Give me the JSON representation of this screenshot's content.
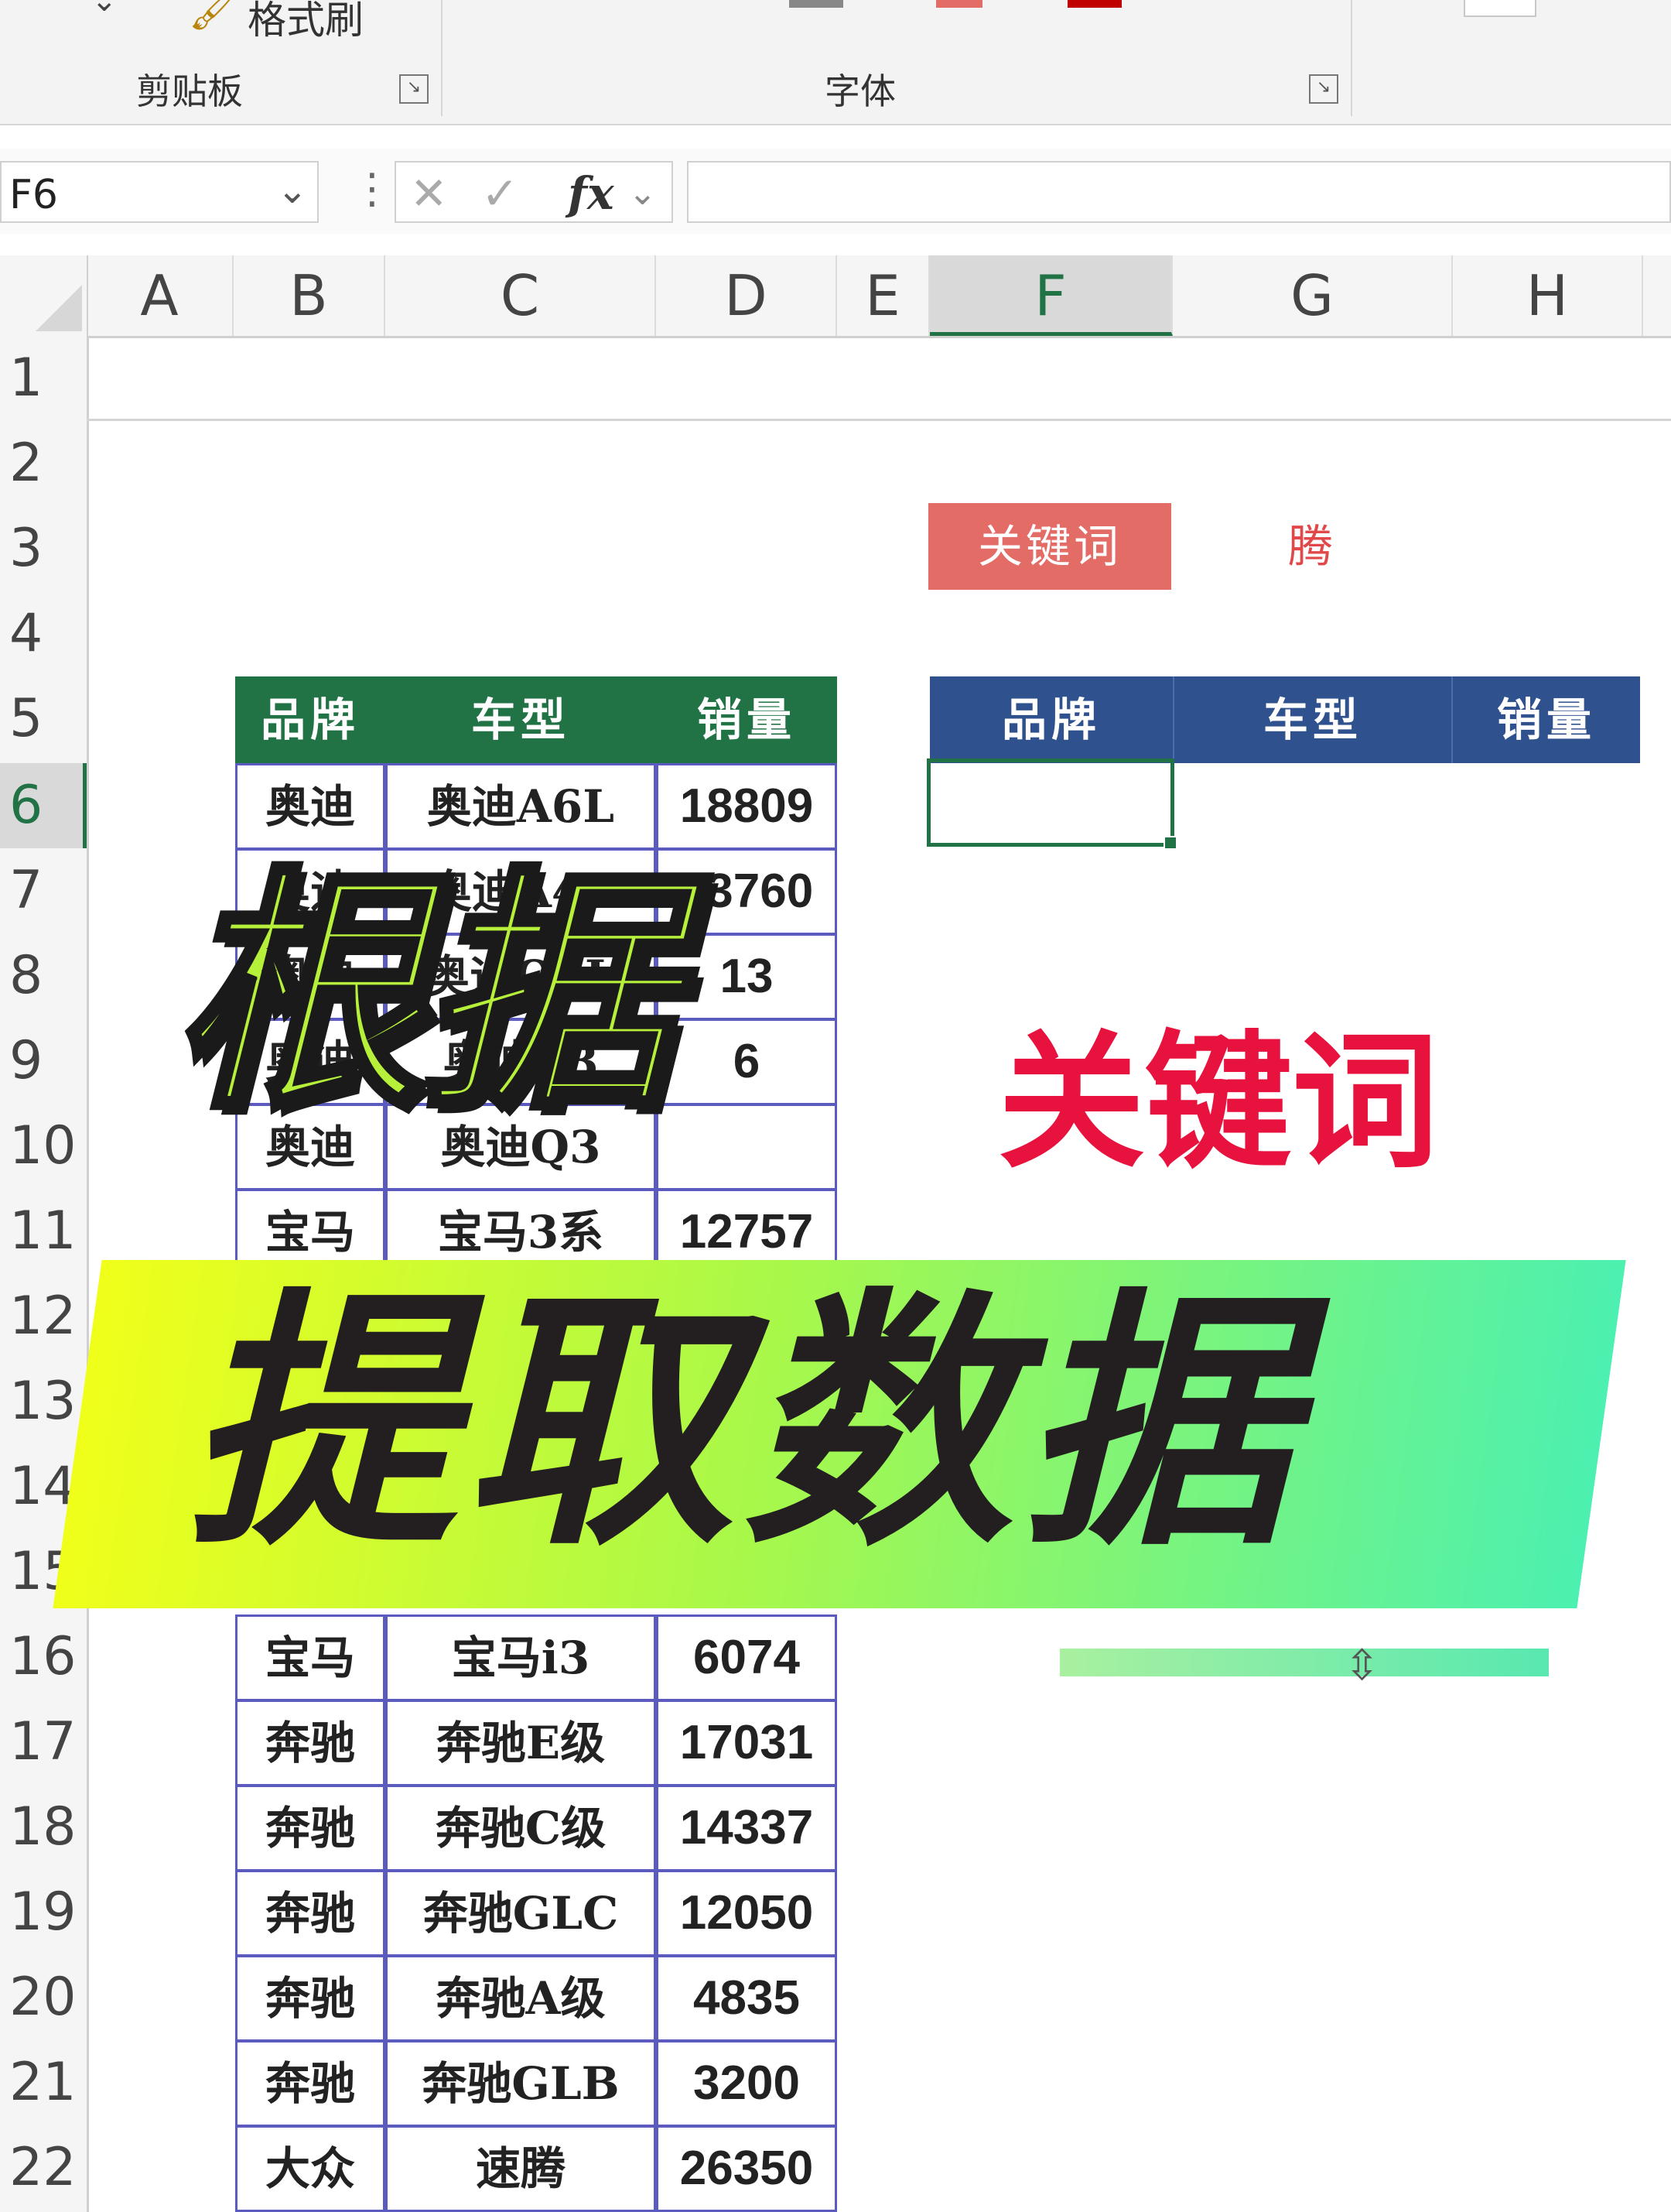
{
  "ribbon": {
    "clipboard_group": "剪贴板",
    "font_group": "字体",
    "format_painter": "格式刷"
  },
  "formula_bar": {
    "name_box": "F6",
    "cancel_symbol": "✕",
    "enter_symbol": "✓",
    "fx_label": "fx",
    "formula": ""
  },
  "columns": [
    "A",
    "B",
    "C",
    "D",
    "E",
    "F",
    "G",
    "H"
  ],
  "selected_column": "F",
  "rows": [
    "1",
    "2",
    "3",
    "4",
    "5",
    "6",
    "7",
    "8",
    "9",
    "10",
    "11",
    "12",
    "13",
    "14",
    "15",
    "16",
    "17",
    "18",
    "19",
    "20",
    "21",
    "22"
  ],
  "selected_row": "6",
  "source_table": {
    "headers": [
      "品牌",
      "车型",
      "销量"
    ],
    "rows": [
      {
        "brand": "奥迪",
        "model": "奥迪A6L",
        "sales": "18809"
      },
      {
        "brand": "奥迪",
        "model": "奥迪A4L",
        "sales": "13760"
      },
      {
        "brand": "奥迪",
        "model": "奥迪Q5L",
        "sales": "13"
      },
      {
        "brand": "奥迪",
        "model": "奥迪A3",
        "sales": "6"
      },
      {
        "brand": "奥迪",
        "model": "奥迪Q3",
        "sales": ""
      },
      {
        "brand": "宝马",
        "model": "宝马3系",
        "sales": "12757"
      },
      {
        "brand": "宝马",
        "model": "宝马i3",
        "sales": "6074"
      },
      {
        "brand": "奔驰",
        "model": "奔驰E级",
        "sales": "17031"
      },
      {
        "brand": "奔驰",
        "model": "奔驰C级",
        "sales": "14337"
      },
      {
        "brand": "奔驰",
        "model": "奔驰GLC",
        "sales": "12050"
      },
      {
        "brand": "奔驰",
        "model": "奔驰A级",
        "sales": "4835"
      },
      {
        "brand": "奔驰",
        "model": "奔驰GLB",
        "sales": "3200"
      },
      {
        "brand": "大众",
        "model": "速腾",
        "sales": "26350"
      }
    ]
  },
  "keyword": {
    "label": "关键词",
    "value": "腾"
  },
  "result_table": {
    "headers": [
      "品牌",
      "车型",
      "销量"
    ]
  },
  "overlay": {
    "title_part1": "根据",
    "title_part2": "关键词",
    "title_part3": "提取数据"
  },
  "colors": {
    "excel_green": "#217346",
    "table_header_green": "#217346",
    "result_header_blue": "#2f528f",
    "keyword_label_red": "#e46c66",
    "title_red": "#e8123e"
  }
}
